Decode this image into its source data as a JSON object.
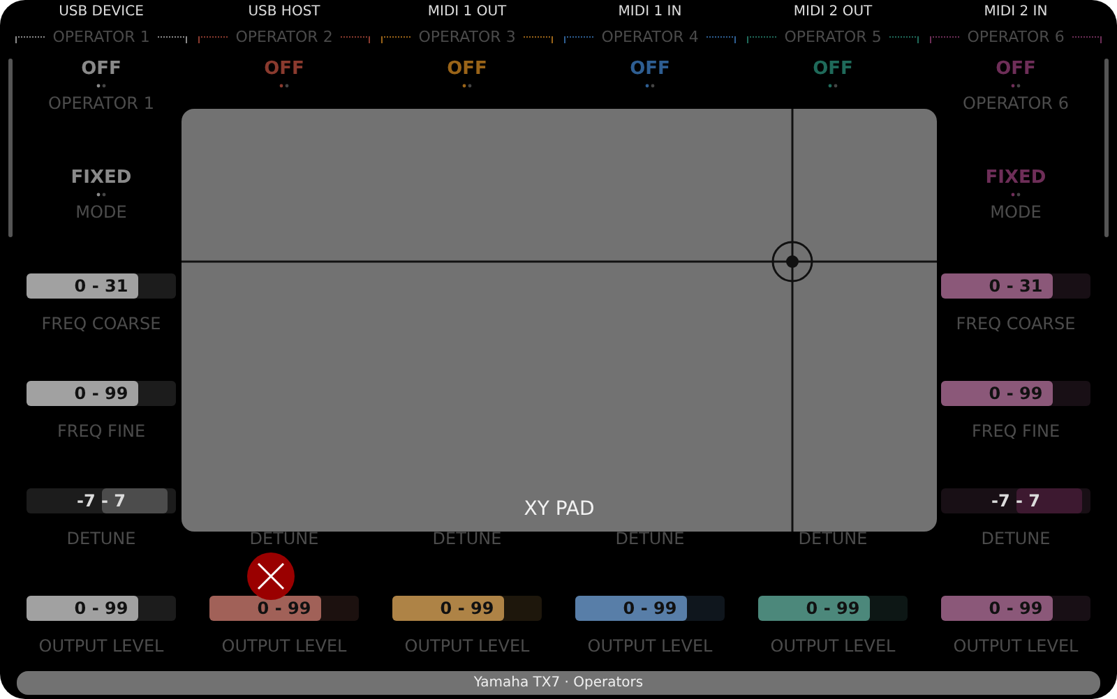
{
  "columns": [
    {
      "heading": "USB DEVICE",
      "group": "OPERATOR 1",
      "color": "#8a8a8a",
      "power": "OFF",
      "name": "OPERATOR 1",
      "mode": {
        "value": "FIXED",
        "label": "MODE"
      },
      "params": [
        {
          "kind": "range",
          "value": "0 - 31",
          "level": 0.75,
          "label": "FREQ COARSE"
        },
        {
          "kind": "range",
          "value": "0 - 99",
          "level": 0.75,
          "label": "FREQ FINE"
        },
        {
          "kind": "bipolar",
          "value": "-7 - 7",
          "level": 0.94,
          "label": "DETUNE"
        },
        {
          "kind": "range",
          "value": "0 - 99",
          "level": 0.75,
          "label": "OUTPUT LEVEL"
        }
      ]
    },
    {
      "heading": "USB HOST",
      "group": "OPERATOR 2",
      "color": "#8a3a2e",
      "power": "OFF",
      "params": [
        {
          "kind": "label",
          "label": "DETUNE"
        },
        {
          "kind": "range",
          "value": "0 - 99",
          "level": 0.75,
          "label": "OUTPUT LEVEL"
        }
      ]
    },
    {
      "heading": "MIDI 1 OUT",
      "group": "OPERATOR 3",
      "color": "#9a6418",
      "power": "OFF",
      "params": [
        {
          "kind": "label",
          "label": "DETUNE"
        },
        {
          "kind": "range",
          "value": "0 - 99",
          "level": 0.75,
          "label": "OUTPUT LEVEL"
        }
      ]
    },
    {
      "heading": "MIDI 1 IN",
      "group": "OPERATOR 4",
      "color": "#2e5e92",
      "power": "OFF",
      "params": [
        {
          "kind": "label",
          "label": "DETUNE"
        },
        {
          "kind": "range",
          "value": "0 - 99",
          "level": 0.75,
          "label": "OUTPUT LEVEL"
        }
      ]
    },
    {
      "heading": "MIDI 2 OUT",
      "group": "OPERATOR 5",
      "color": "#1f6a5a",
      "power": "OFF",
      "params": [
        {
          "kind": "label",
          "label": "DETUNE"
        },
        {
          "kind": "range",
          "value": "0 - 99",
          "level": 0.75,
          "label": "OUTPUT LEVEL"
        }
      ]
    },
    {
      "heading": "MIDI 2 IN",
      "group": "OPERATOR 6",
      "color": "#6e2e58",
      "power": "OFF",
      "name": "OPERATOR 6",
      "mode": {
        "value": "FIXED",
        "label": "MODE"
      },
      "params": [
        {
          "kind": "range",
          "value": "0 - 31",
          "level": 0.75,
          "label": "FREQ COARSE"
        },
        {
          "kind": "range",
          "value": "0 - 99",
          "level": 0.75,
          "label": "FREQ FINE"
        },
        {
          "kind": "bipolar",
          "value": "-7 - 7",
          "level": 0.94,
          "label": "DETUNE"
        },
        {
          "kind": "range",
          "value": "0 - 99",
          "level": 0.75,
          "label": "OUTPUT LEVEL"
        }
      ]
    }
  ],
  "xy_pad": {
    "label": "XY PAD"
  },
  "status_bar": {
    "title": "Yamaha TX7 · Operators"
  }
}
